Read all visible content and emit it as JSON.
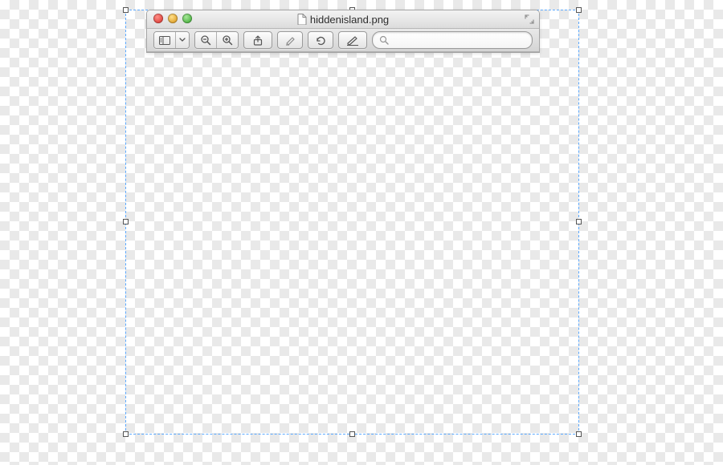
{
  "window": {
    "title": "hiddenisland.png"
  },
  "toolbar": {
    "search_placeholder": ""
  }
}
